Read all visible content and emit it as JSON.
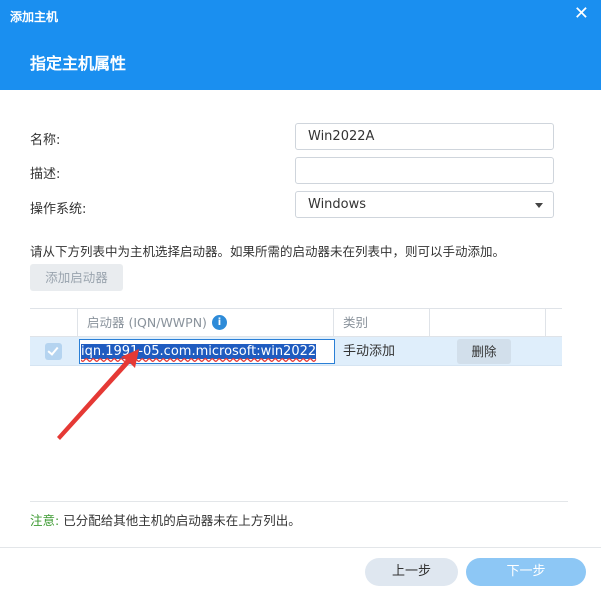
{
  "window": {
    "title": "添加主机",
    "close_icon": "close-icon"
  },
  "step": {
    "title": "指定主机属性"
  },
  "form": {
    "name_label": "名称:",
    "name_value": "Win2022A",
    "desc_label": "描述:",
    "desc_value": "",
    "os_label": "操作系统:",
    "os_value": "Windows"
  },
  "initiators": {
    "hint": "请从下方列表中为主机选择启动器。如果所需的启动器未在列表中，则可以手动添加。",
    "add_button": "添加启动器",
    "columns": {
      "initiator": "启动器 (IQN/WWPN)",
      "type": "类别"
    },
    "info_icon": "i",
    "rows": [
      {
        "initiator": "iqn.1991-05.com.microsoft:win2022",
        "type": "手动添加",
        "delete_label": "删除"
      }
    ]
  },
  "note": {
    "prefix": "注意:",
    "text": " 已分配给其他主机的启动器未在上方列出。"
  },
  "footer": {
    "prev": "上一步",
    "next": "下一步"
  },
  "colors": {
    "header_bg": "#1a8ff0",
    "primary": "#1a8ff0",
    "note_green": "#3d9a32",
    "annotation_arrow": "#e53935"
  }
}
